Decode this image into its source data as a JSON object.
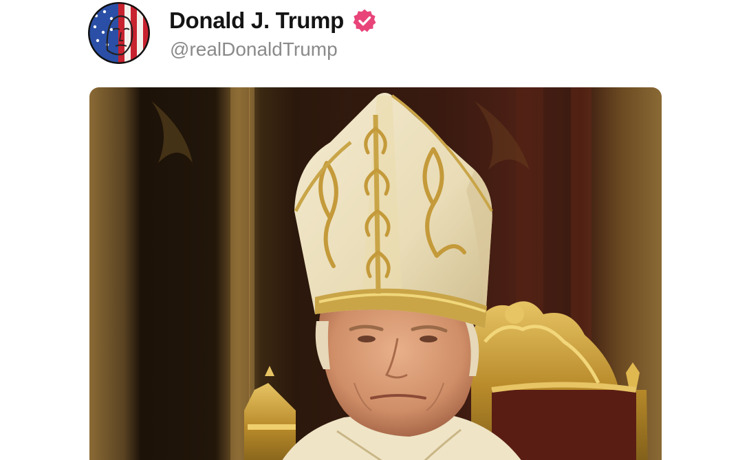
{
  "post": {
    "author": {
      "display_name": "Donald J. Trump",
      "handle": "@realDonaldTrump",
      "verified": true,
      "verified_badge_color": "#e8447a",
      "avatar_icon": "american-flag-face-avatar"
    },
    "media": {
      "kind": "image",
      "subject": "man-in-papal-mitre-on-gold-throne"
    }
  },
  "colors": {
    "name_text": "#141414",
    "handle_text": "#8a8a8a",
    "background": "#ffffff",
    "verified_badge": "#e8447a"
  }
}
